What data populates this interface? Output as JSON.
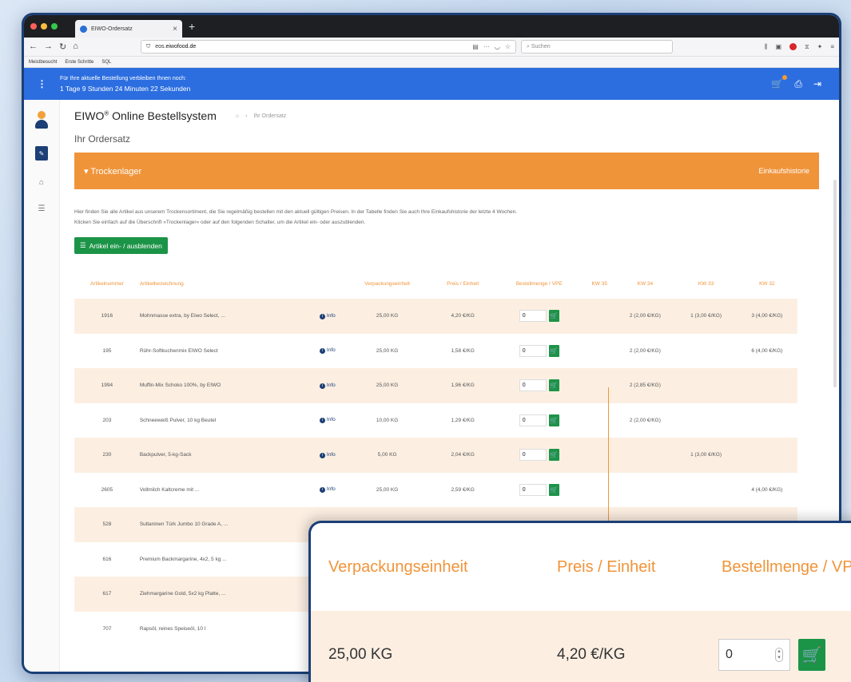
{
  "browser": {
    "tab_title": "EIWO-Ordersatz",
    "url_host": "eos.",
    "url_domain": "eiwofood.de",
    "search_placeholder": "Suchen",
    "bookmarks": [
      "Meistbesucht",
      "Erste Schritte",
      "SQL"
    ]
  },
  "banner": {
    "line1": "Für Ihre aktuelle Bestellung verbleiben Ihnen noch:",
    "line2": "1 Tage 9 Stunden 24 Minuten 22 Sekunden"
  },
  "header": {
    "app_title": "EIWO",
    "app_sup": "®",
    "app_title_rest": " Online Bestellsystem",
    "breadcrumb": "Ihr Ordersatz",
    "subtitle": "Ihr Ordersatz"
  },
  "section": {
    "title": "Trockenlager",
    "history_label": "Einkaufshistorie",
    "desc1": "Hier finden Sie alle Artikel aus unserem Trockensortiment, die Sie regelmäßig bestellen mit den aktuell gültigen Preisen. In der Tabelle finden Sie auch Ihre Einkaufshistorie der letzte 4 Wochen.",
    "desc2": "Klicken Sie einfach auf die Überschrift »Trockenlager« oder auf den folgenden Schalter, um die Artikel ein- oder auszublenden.",
    "toggle_label": "Artikel ein- / ausblenden"
  },
  "table": {
    "headers": [
      "Artikelnummer",
      "Artikelbezeichnung",
      "",
      "Verpackungseinheit",
      "Preis / Einheit",
      "Bestellmenge / VPE",
      "KW 35",
      "KW 34",
      "KW 33",
      "KW 32"
    ],
    "info_label": "Info",
    "rows": [
      {
        "nr": "1916",
        "name": "Mohnmasse extra, by Eiwo Select, ...",
        "vpe": "25,00 KG",
        "price": "4,20 €/KG",
        "qty": "0",
        "kw35": "",
        "kw34": "2 (2,00 €/KG)",
        "kw33": "1 (3,00 €/KG)",
        "kw32": "3 (4,00 €/KG)"
      },
      {
        "nr": "195",
        "name": "Rühr-Softkuchenmix EIWO Select",
        "vpe": "25,00 KG",
        "price": "1,58 €/KG",
        "qty": "0",
        "kw35": "",
        "kw34": "2 (2,00 €/KG)",
        "kw33": "",
        "kw32": "6 (4,00 €/KG)"
      },
      {
        "nr": "1994",
        "name": "Muffin-Mix Schoko 100%, by EIWO",
        "vpe": "25,00 KG",
        "price": "1,96 €/KG",
        "qty": "0",
        "kw35": "",
        "kw34": "2 (2,85 €/KG)",
        "kw33": "",
        "kw32": ""
      },
      {
        "nr": "203",
        "name": "Schneeweiß Pulver, 10 kg Beutel",
        "vpe": "10,00 KG",
        "price": "1,29 €/KG",
        "qty": "0",
        "kw35": "",
        "kw34": "2 (2,00 €/KG)",
        "kw33": "",
        "kw32": ""
      },
      {
        "nr": "230",
        "name": "Backpulver, 5-kg-Sack",
        "vpe": "5,00 KG",
        "price": "2,04 €/KG",
        "qty": "0",
        "kw35": "",
        "kw34": "",
        "kw33": "1 (3,00 €/KG)",
        "kw32": ""
      },
      {
        "nr": "2605",
        "name": "Vollmilch Kaltcreme mit ...",
        "vpe": "25,00 KG",
        "price": "2,59 €/KG",
        "qty": "0",
        "kw35": "",
        "kw34": "",
        "kw33": "",
        "kw32": "4 (4,00 €/KG)"
      },
      {
        "nr": "528",
        "name": "Sultaninen Türk Jumbo 10 Grade A, ...",
        "vpe": "",
        "price": "",
        "qty": "",
        "kw35": "",
        "kw34": "",
        "kw33": "",
        "kw32": ""
      },
      {
        "nr": "616",
        "name": "Premium Backmargarine, 4x2, 5 kg ...",
        "vpe": "",
        "price": "",
        "qty": "",
        "kw35": "",
        "kw34": "",
        "kw33": "",
        "kw32": ""
      },
      {
        "nr": "617",
        "name": "Ziehmargarine Gold, 5x2 kg Platte, ...",
        "vpe": "",
        "price": "",
        "qty": "",
        "kw35": "",
        "kw34": "",
        "kw33": "",
        "kw32": ""
      },
      {
        "nr": "707",
        "name": "Rapsöl, reines Speiseöl, 10 l",
        "vpe": "",
        "price": "",
        "qty": "",
        "kw35": "",
        "kw34": "",
        "kw33": "",
        "kw32": ""
      }
    ]
  },
  "zoom": {
    "h1": "Verpackungseinheit",
    "h2": "Preis / Einheit",
    "h3": "Bestellmenge / VPE",
    "v1": "25,00 KG",
    "v2": "4,20 €/KG",
    "v3": "0"
  },
  "colors": {
    "blue": "#2c6ee0",
    "orange": "#f0943a",
    "green": "#1c9447",
    "navy": "#1c3f75"
  }
}
